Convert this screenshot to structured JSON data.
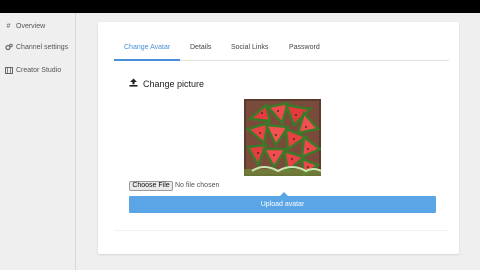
{
  "sidebar": {
    "items": [
      {
        "label": "Overview",
        "icon": "hash-icon"
      },
      {
        "label": "Channel settings",
        "icon": "gears-icon"
      },
      {
        "label": "Creator Studio",
        "icon": "film-icon"
      }
    ]
  },
  "tabs": [
    {
      "label": "Change Avatar",
      "active": true
    },
    {
      "label": "Details",
      "active": false
    },
    {
      "label": "Social Links",
      "active": false
    },
    {
      "label": "Password",
      "active": false
    }
  ],
  "avatar": {
    "heading": "Change picture",
    "heading_icon": "upload-icon",
    "image_icon": "watermelon-slices-image"
  },
  "file_input": {
    "button_label": "Choose File",
    "status": "No file chosen"
  },
  "upload": {
    "button_label": "Upload avatar"
  },
  "colors": {
    "accent": "#4a90d9",
    "button": "#5aa5e6",
    "background": "#efefef"
  }
}
